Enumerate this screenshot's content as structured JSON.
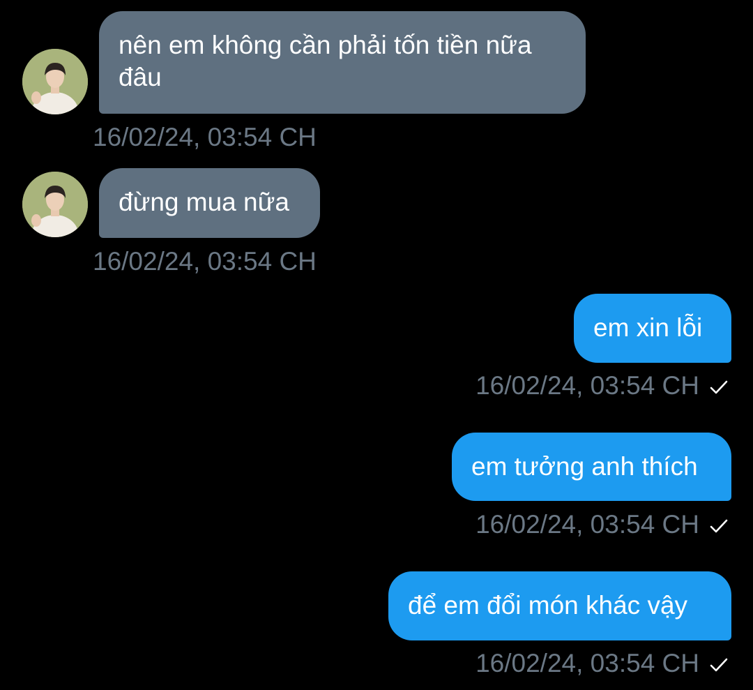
{
  "messages": [
    {
      "direction": "incoming",
      "text": "nên em không cần phải tốn tiền nữa đâu",
      "timestamp": "16/02/24, 03:54 CH"
    },
    {
      "direction": "incoming",
      "text": "đừng mua nữa",
      "timestamp": "16/02/24, 03:54 CH"
    },
    {
      "direction": "outgoing",
      "text": "em xin lỗi",
      "timestamp": "16/02/24, 03:54 CH",
      "status_icon": "check-icon"
    },
    {
      "direction": "outgoing",
      "text": "em tưởng anh thích",
      "timestamp": "16/02/24, 03:54 CH",
      "status_icon": "check-icon"
    },
    {
      "direction": "outgoing",
      "text": "để em đổi món khác vậy",
      "timestamp": "16/02/24, 03:54 CH",
      "status_icon": "check-icon"
    }
  ],
  "colors": {
    "background": "#000000",
    "incoming_bubble": "#5f7080",
    "outgoing_bubble": "#1d9bf0",
    "timestamp": "#6b7885",
    "text": "#ffffff"
  }
}
